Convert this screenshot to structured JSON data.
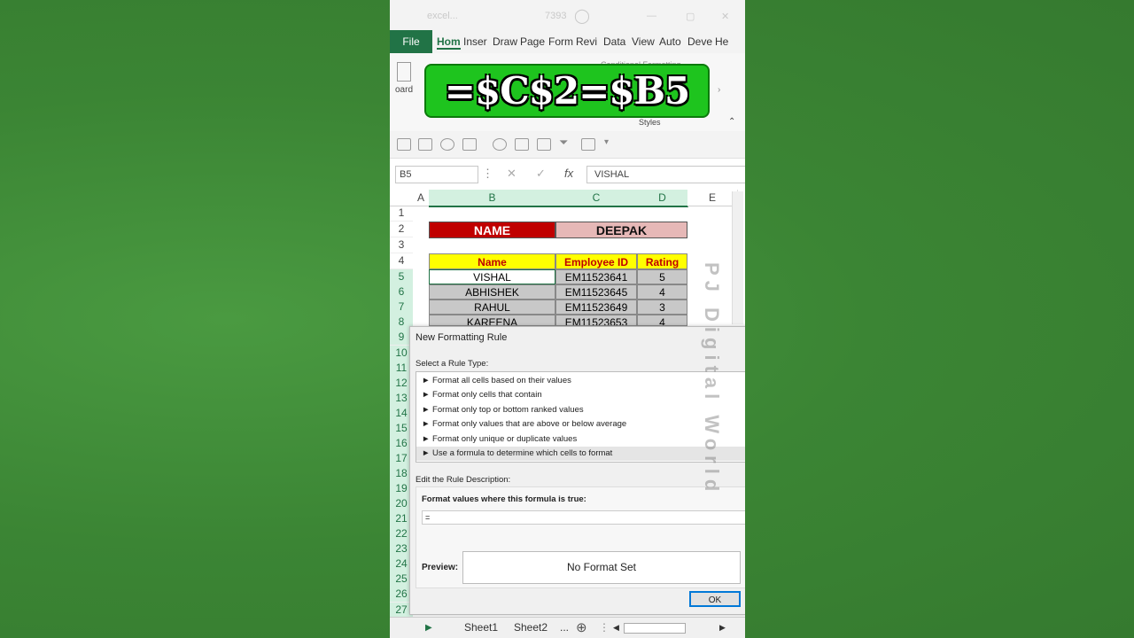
{
  "titlebar": {
    "file": "excel...",
    "code": "7393"
  },
  "ribbon_tabs": [
    "File",
    "Hom",
    "Inser",
    "Draw",
    "Page",
    "Form",
    "Revi",
    "Data",
    "View",
    "Auto",
    "Deve",
    "He"
  ],
  "ribbon": {
    "clipboard_label": "oard",
    "styles_label": "Styles",
    "cond_format": "Conditional Formatting"
  },
  "banner": {
    "formula": "=$C$2=$B5"
  },
  "formula_bar": {
    "name_box": "B5",
    "fx": "fx",
    "value": "VISHAL"
  },
  "columns": [
    "A",
    "B",
    "C",
    "D",
    "E"
  ],
  "rows": [
    "1",
    "2",
    "3",
    "4",
    "5",
    "6",
    "7",
    "8",
    "9",
    "10",
    "11",
    "12",
    "13",
    "14",
    "15",
    "16",
    "17",
    "18",
    "19",
    "20",
    "21",
    "22",
    "23",
    "24",
    "25",
    "26",
    "27"
  ],
  "sheet": {
    "name_label": "NAME",
    "name_value": "DEEPAK",
    "headers": [
      "Name",
      "Employee ID",
      "Rating"
    ],
    "data": [
      [
        "VISHAL",
        "EM11523641",
        "5"
      ],
      [
        "ABHISHEK",
        "EM11523645",
        "4"
      ],
      [
        "RAHUL",
        "EM11523649",
        "3"
      ],
      [
        "KAREENA",
        "EM11523653",
        "4"
      ]
    ]
  },
  "dialog": {
    "title": "New Formatting Rule",
    "select_label": "Select a Rule Type:",
    "rules": [
      "► Format all cells based on their values",
      "► Format only cells that contain",
      "► Format only top or bottom ranked values",
      "► Format only values that are above or below average",
      "► Format only unique or duplicate values",
      "► Use a formula to determine which cells to format"
    ],
    "edit_label": "Edit the Rule Description:",
    "formula_label": "Format values where this formula is true:",
    "formula_value": "=",
    "preview_label": "Preview:",
    "preview_value": "No Format Set",
    "ok": "OK"
  },
  "watermark": "PJ Digital World",
  "sheet_tabs": [
    "Sheet1",
    "Sheet2",
    "..."
  ],
  "colors": {
    "excel_green": "#217346",
    "name_red": "#c00000",
    "header_yellow": "#ffff00",
    "banner_green": "#1ec41e"
  }
}
